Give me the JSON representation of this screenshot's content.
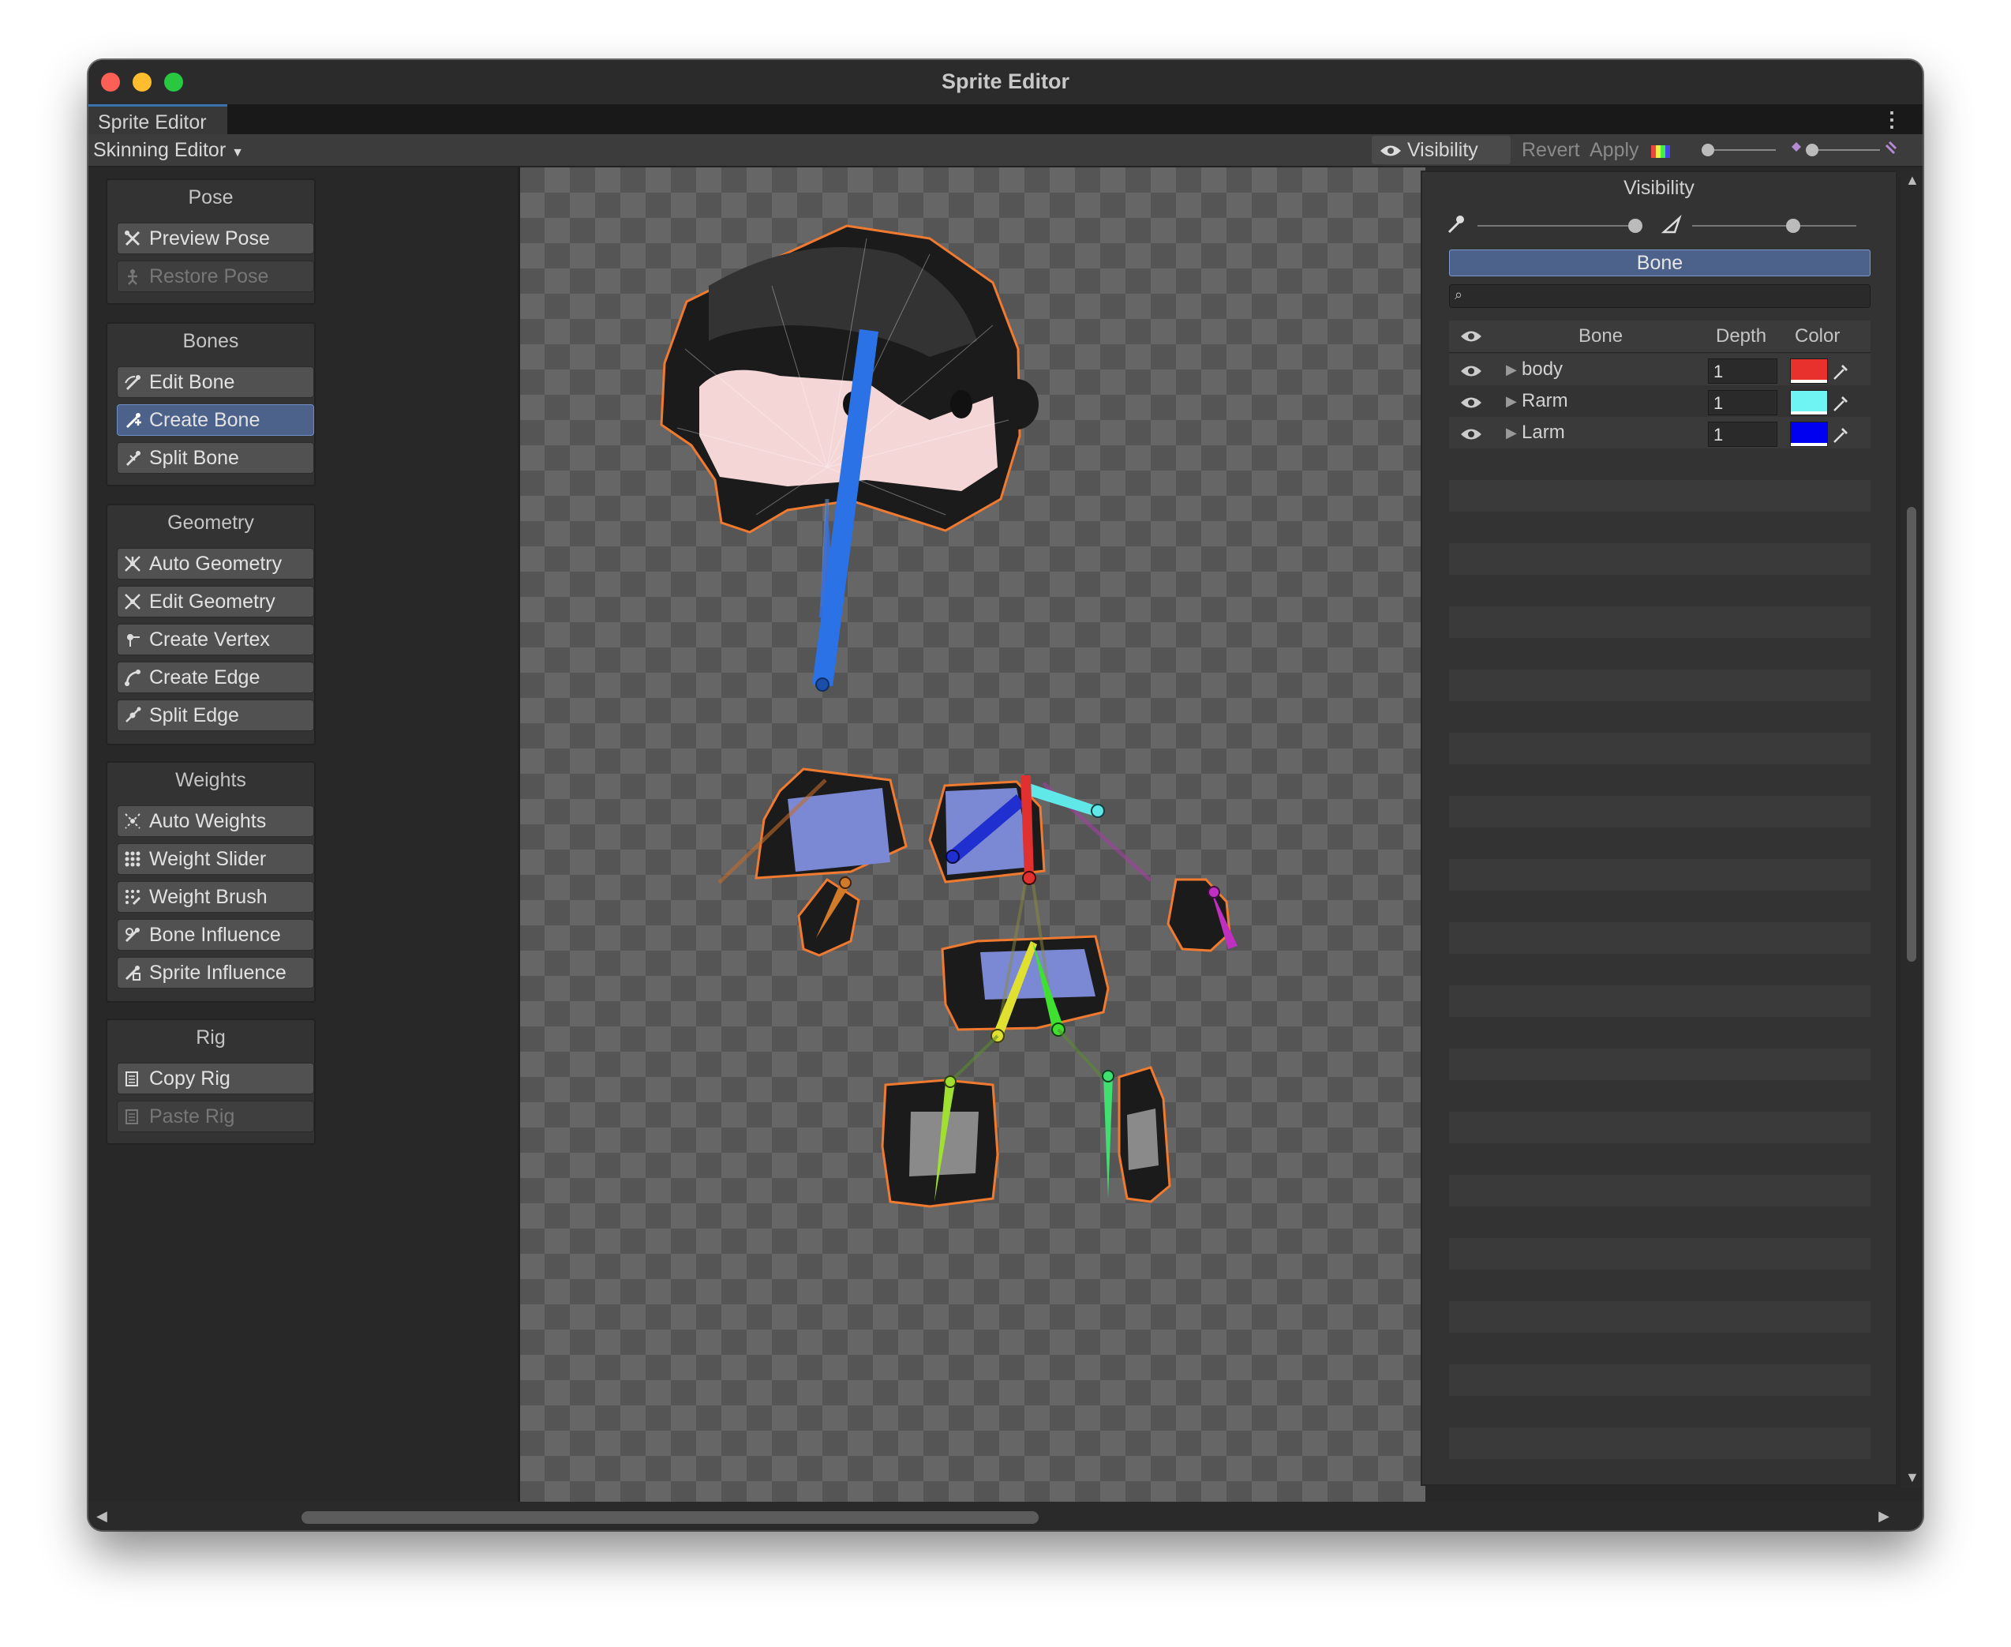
{
  "window": {
    "title": "Sprite Editor"
  },
  "tab": {
    "label": "Sprite Editor"
  },
  "toolbar": {
    "mode": "Skinning Editor",
    "visibility": "Visibility",
    "revert": "Revert",
    "apply": "Apply"
  },
  "panels": {
    "pose": {
      "title": "Pose",
      "buttons": [
        "Preview Pose",
        "Restore Pose"
      ]
    },
    "bones": {
      "title": "Bones",
      "buttons": [
        "Edit Bone",
        "Create Bone",
        "Split Bone"
      ]
    },
    "geometry": {
      "title": "Geometry",
      "buttons": [
        "Auto Geometry",
        "Edit Geometry",
        "Create Vertex",
        "Create Edge",
        "Split Edge"
      ]
    },
    "weights": {
      "title": "Weights",
      "buttons": [
        "Auto Weights",
        "Weight Slider",
        "Weight Brush",
        "Bone Influence",
        "Sprite Influence"
      ]
    },
    "rig": {
      "title": "Rig",
      "buttons": [
        "Copy Rig",
        "Paste Rig"
      ]
    }
  },
  "selected_tool": "Create Bone",
  "disabled_tools": [
    "Restore Pose",
    "Paste Rig"
  ],
  "visibility_panel": {
    "title": "Visibility",
    "active_tab": "Bone",
    "search_placeholder": "",
    "columns": {
      "bone": "Bone",
      "depth": "Depth",
      "color": "Color"
    },
    "bones": [
      {
        "name": "body",
        "depth": "1",
        "color": "#e8302c"
      },
      {
        "name": "Rarm",
        "depth": "1",
        "color": "#6ff4f4"
      },
      {
        "name": "Larm",
        "depth": "1",
        "color": "#0000f0"
      }
    ]
  },
  "icons": [
    "visibility-eye-icon",
    "kebab-menu-icon",
    "dropdown-arrow-icon",
    "color-swatch-icon",
    "bone-opacity-icon",
    "mesh-opacity-icon",
    "search-icon",
    "eyedropper-icon",
    "expand-arrow-icon"
  ]
}
